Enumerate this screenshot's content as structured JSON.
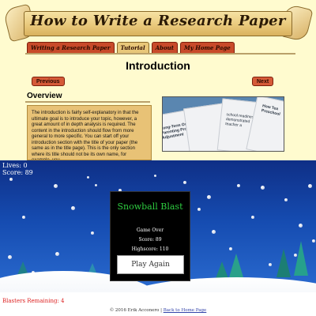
{
  "site": {
    "title": "How to Write a Research Paper"
  },
  "nav": {
    "tabs": [
      {
        "label": "Writing a Research Paper"
      },
      {
        "label": "Tutorial"
      },
      {
        "label": "About"
      },
      {
        "label": "My Home Page"
      }
    ]
  },
  "page": {
    "heading": "Introduction",
    "prev_label": "Previous",
    "next_label": "Next",
    "section_title": "Overview",
    "body_text": "The introduction is fairly self-explanatory in that the ultimate goal is to introduce your topic, however, a great amount of in depth analysis is required. The content in the introduction should flow from more general to more specific. You can start off your introduction section with the title of your paper (the same as in the title page). This is the only section where its title should not be its own name, for example, you"
  },
  "image_text": {
    "paper_a": "Long-Term Outc\nParenting Progr\nAdjustment",
    "paper_b": "school readiness\ndemonstrated\nteacher a",
    "paper_c": "How Tea\nPreschool"
  },
  "game": {
    "lives_text": "Lives: 0",
    "score_text": "Score: 89",
    "dialog_title": "Snowball Blast",
    "game_over": "Game Over",
    "score_line": "Score: 89",
    "highscore_line": "Highscore: 110",
    "play_again_label": "Play Again",
    "status_text": "Blasters Remaining: 4"
  },
  "footer": {
    "copyright": "© 2016 Erik Acconero | ",
    "link_label": "Back to Home Page"
  },
  "colors": {
    "tab": "#c84a2a",
    "tab_active": "#e8c779",
    "page_bg": "#fffbcf",
    "dialog_title": "#2ecc40"
  }
}
